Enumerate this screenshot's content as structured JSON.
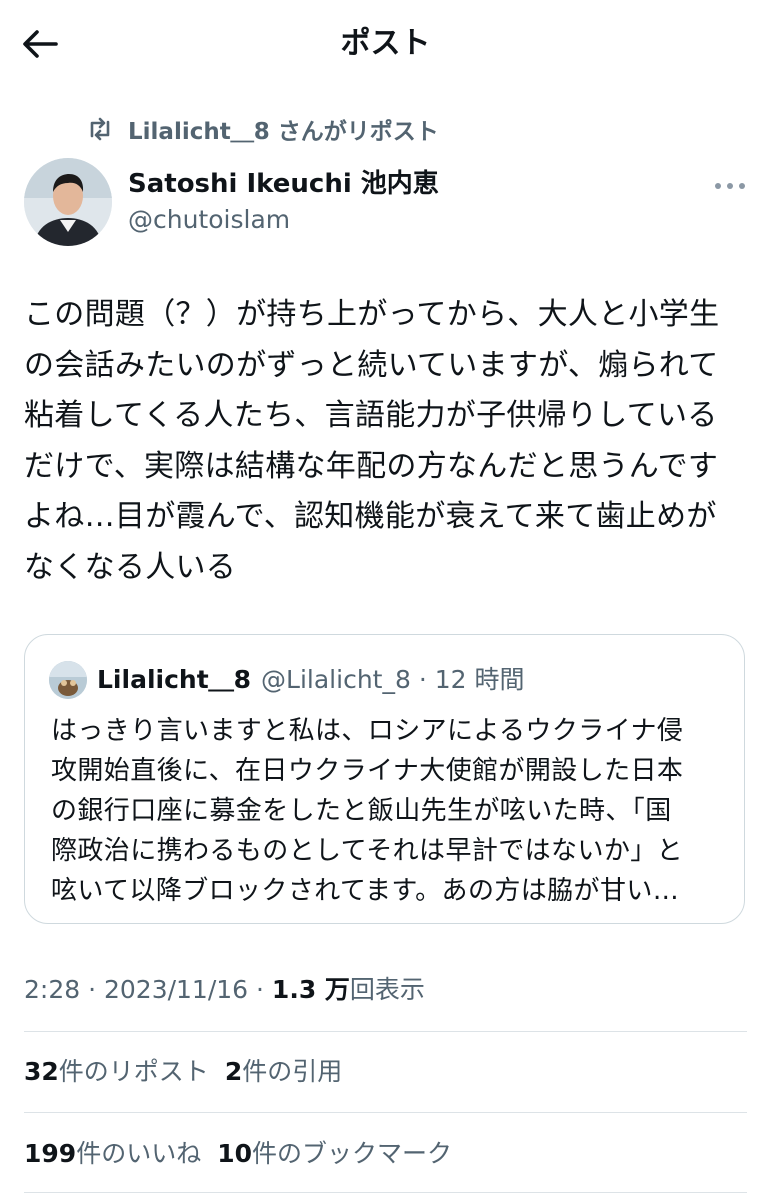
{
  "header": {
    "title": "ポスト"
  },
  "repost": {
    "text": "Lilalicht＿8 さんがリポスト"
  },
  "tweet": {
    "author_name": "Satoshi Ikeuchi 池内恵",
    "author_handle": "@chutoislam",
    "lines": [
      "この問題（？）が持ち上がってから、大人と小学生",
      "の会話みたいのがずっと続いていますが、煽られて",
      "粘着してくる人たち、言語能力が子供帰りしている",
      "だけで、実際は結構な年配の方なんだと思うんです",
      "よね…目が霞んで、認知機能が衰えて来て歯止めが",
      "なくなる人いる"
    ]
  },
  "quote": {
    "author_name": "Lilalicht＿8",
    "meta": "@Lilalicht_8 · 12 時間",
    "lines": [
      "はっきり言いますと私は、ロシアによるウクライナ侵",
      "攻開始直後に、在日ウクライナ大使館が開設した日本",
      "の銀行口座に募金をしたと飯山先生が呟いた時、「国",
      "際政治に携わるものとしてそれは早計ではないか」と",
      "呟いて以降ブロックされてます。あの方は脇が甘い…"
    ]
  },
  "meta": {
    "time": "2:28 · 2023/11/16 · ",
    "views_count": "1.3 万",
    "views_label": "回表示"
  },
  "stats": {
    "reposts_count": "32",
    "reposts_label": "件のリポスト",
    "quotes_count": "2",
    "quotes_label": "件の引用",
    "likes_count": "199",
    "likes_label": "件のいいね",
    "bookmarks_count": "10",
    "bookmarks_label": "件のブックマーク"
  },
  "colors": {
    "text": "#0f1419",
    "secondary": "#536471",
    "border": "#cfd9de"
  },
  "icons": {
    "back": "arrow-left-icon",
    "repost": "repost-icon",
    "more": "more-horizontal-icon"
  }
}
